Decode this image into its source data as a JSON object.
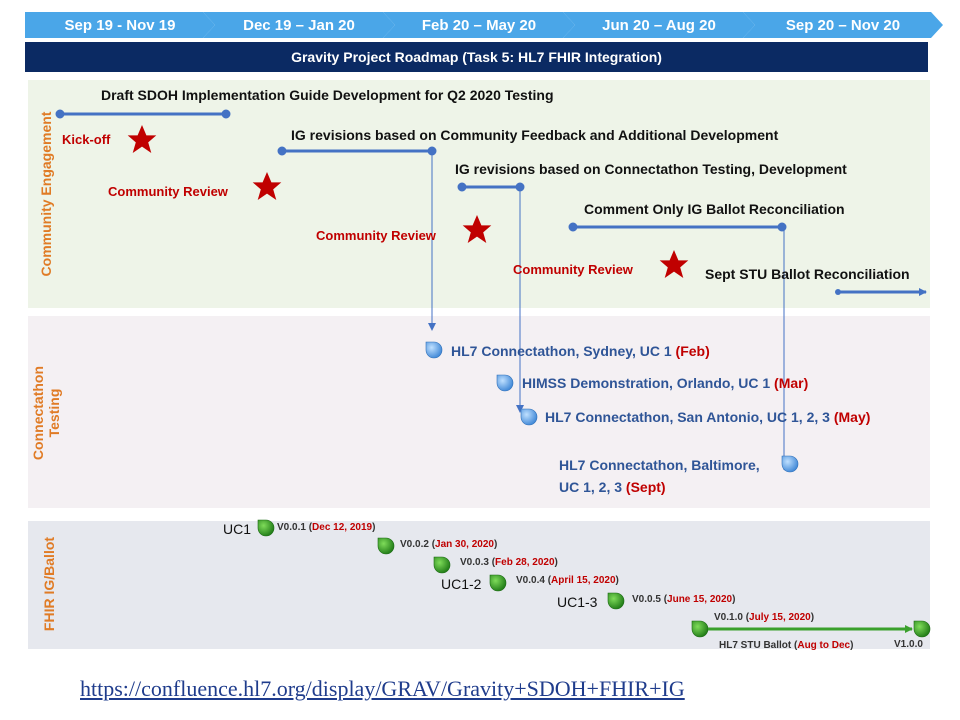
{
  "timeline": [
    {
      "label": "Sep 19 - Nov 19"
    },
    {
      "label": "Dec 19 – Jan 20"
    },
    {
      "label": "Feb 20 – May 20"
    },
    {
      "label": "Jun 20 – Aug 20"
    },
    {
      "label": "Sep 20 – Nov 20"
    }
  ],
  "title": "Gravity Project Roadmap (Task 5: HL7 FHIR Integration)",
  "lanes": {
    "community": "Community Engagement",
    "connectathon_line1": "Connectathon",
    "connectathon_line2": "Testing",
    "fhir": "FHIR IG/Ballot"
  },
  "tasks": {
    "draft": "Draft SDOH Implementation Guide Development for Q2 2020 Testing",
    "ig_feedback": "IG revisions based on Community Feedback and Additional Development",
    "ig_connectathon": "IG revisions based on Connectathon Testing, Development",
    "comment_only": "Comment Only IG Ballot Reconciliation",
    "sept_stu": "Sept STU Ballot Reconciliation"
  },
  "milestones": {
    "kickoff": "Kick-off",
    "review": "Community Review"
  },
  "events": [
    {
      "text": "HL7 Connectathon, Sydney, UC 1 ",
      "when": "(Feb)"
    },
    {
      "text": "HIMSS Demonstration, Orlando, UC 1 ",
      "when": "(Mar)"
    },
    {
      "text": "HL7 Connectathon, San Antonio,  UC 1, 2, 3 ",
      "when": "(May)"
    },
    {
      "text": "HL7 Connectathon, Baltimore,",
      "text2": "UC 1, 2, 3 ",
      "when": "(Sept)"
    }
  ],
  "versions": [
    {
      "ver": "V0.0.1 (",
      "date": "Dec 12, 2019",
      "end": ")"
    },
    {
      "ver": "V0.0.2 (",
      "date": "Jan 30, 2020",
      "end": ")"
    },
    {
      "ver": "V0.0.3 (",
      "date": "Feb 28, 2020",
      "end": ")"
    },
    {
      "ver": "V0.0.4 (",
      "date": "April 15, 2020",
      "end": ")"
    },
    {
      "ver": "V0.0.5 (",
      "date": "June 15, 2020",
      "end": ")"
    },
    {
      "ver": "V0.1.0 (",
      "date": "July 15, 2020",
      "end": ")"
    }
  ],
  "ballot": {
    "text": "HL7 STU Ballot (",
    "when": "Aug to Dec",
    "end": ")",
    "final": "V1.0.0"
  },
  "use_cases": [
    "UC1",
    "UC1-2",
    "UC1-3"
  ],
  "link": "https://confluence.hl7.org/display/GRAV/Gravity+SDOH+FHIR+IG",
  "colors": {
    "chevron": "#4aa6e8",
    "title_bar": "#0b2a63",
    "star": "#c00000",
    "bar": "#4472c4",
    "leaf": "#3aa02c"
  }
}
